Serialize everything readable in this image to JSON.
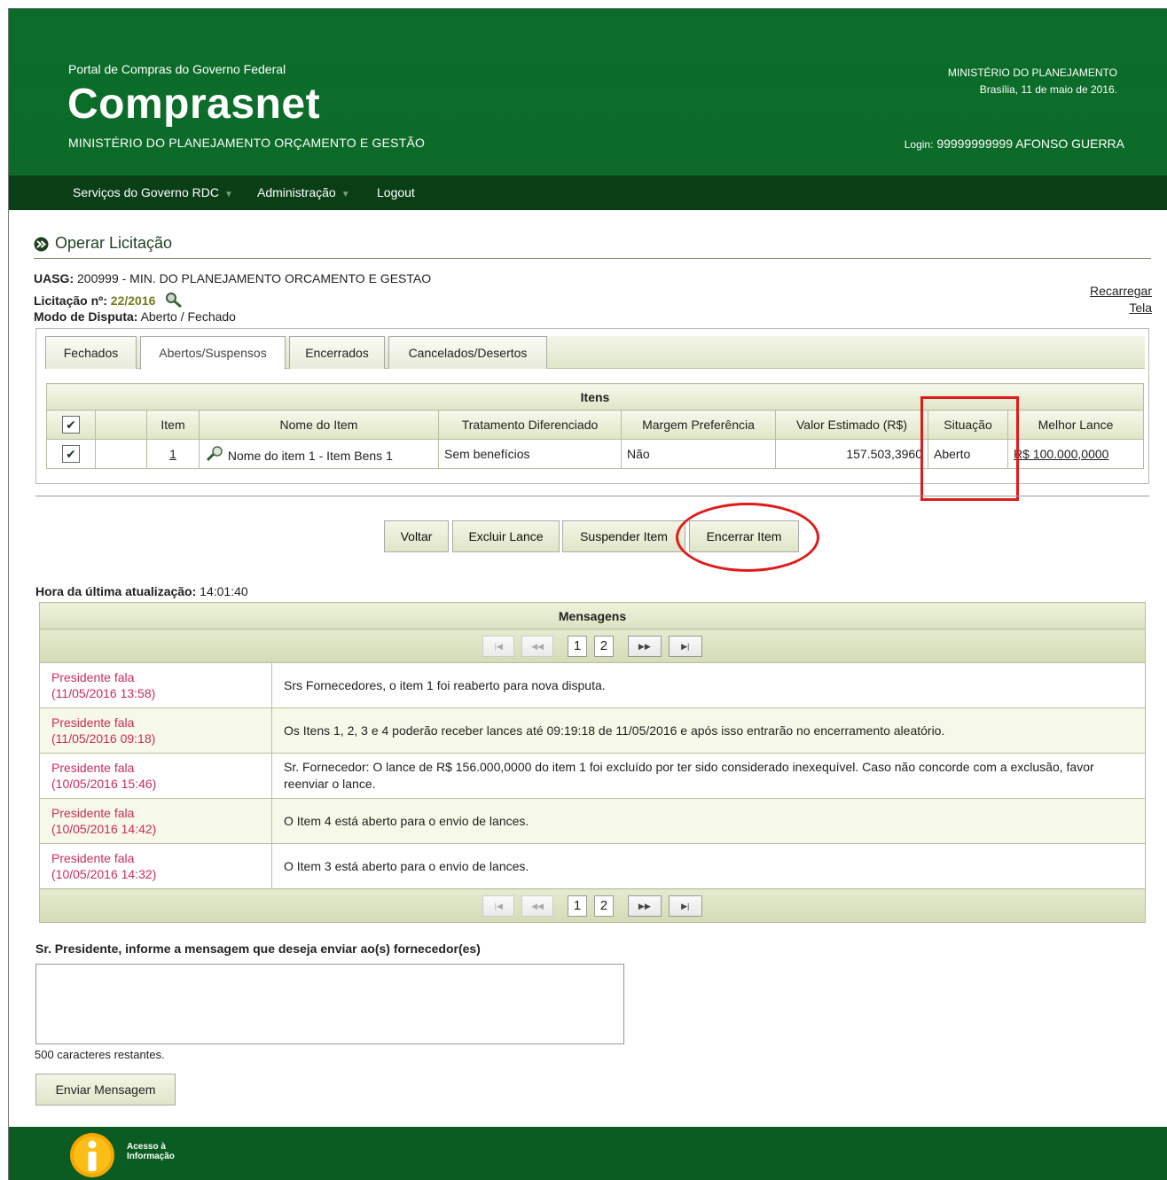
{
  "header": {
    "portal": "Portal de Compras do Governo Federal",
    "brand": "Comprasnet",
    "ministry_sub": "MINISTÉRIO DO PLANEJAMENTO ORÇAMENTO E GESTÃO",
    "right_ministry": "MINISTÉRIO DO PLANEJAMENTO",
    "date": "Brasília, 11 de maio de 2016.",
    "login_label": "Login:",
    "login_user": "99999999999 AFONSO GUERRA"
  },
  "menu": {
    "items": [
      {
        "label": "Serviços do Governo RDC"
      },
      {
        "label": "Administração"
      },
      {
        "label": "Logout"
      }
    ]
  },
  "page": {
    "title": "Operar Licitação",
    "uasg_label": "UASG:",
    "uasg_value": "200999 - MIN. DO PLANEJAMENTO ORCAMENTO E GESTAO",
    "licitacao_label": "Licitação nº:",
    "licitacao_value": "22/2016",
    "modo_label": "Modo de Disputa:",
    "modo_value": "Aberto / Fechado",
    "reload_line1": "Recarregar",
    "reload_line2": "Tela"
  },
  "tabs": [
    {
      "label": "Fechados"
    },
    {
      "label": "Abertos/Suspensos"
    },
    {
      "label": "Encerrados"
    },
    {
      "label": "Cancelados/Desertos"
    }
  ],
  "items_table": {
    "caption": "Itens",
    "columns": [
      "Item",
      "Nome do Item",
      "Tratamento Diferenciado",
      "Margem Preferência",
      "Valor Estimado (R$)",
      "Situação",
      "Melhor Lance"
    ],
    "rows": [
      {
        "item": "1",
        "nome": "Nome do item 1 - Item Bens 1",
        "tratamento": "Sem benefícios",
        "margem": "Não",
        "valor": "157.503,3960",
        "situacao": "Aberto",
        "lance_currency": "R$",
        "lance_value": "100.000,0000"
      }
    ]
  },
  "buttons": {
    "voltar": "Voltar",
    "excluir": "Excluir Lance",
    "suspender": "Suspender Item",
    "encerrar": "Encerrar Item"
  },
  "update": {
    "label": "Hora da última atualização:",
    "time": "14:01:40"
  },
  "messages": {
    "title": "Mensagens",
    "pages": [
      "1",
      "2"
    ],
    "rows": [
      {
        "who": "Presidente fala",
        "when": "(11/05/2016 13:58)",
        "text": "Srs Fornecedores, o item 1 foi reaberto para nova disputa."
      },
      {
        "who": "Presidente fala",
        "when": "(11/05/2016 09:18)",
        "text": "Os Itens 1, 2, 3 e 4 poderão receber lances até 09:19:18 de 11/05/2016 e após isso entrarão no encerramento aleatório."
      },
      {
        "who": "Presidente fala",
        "when": "(10/05/2016 15:46)",
        "text": "Sr. Fornecedor: O lance de R$ 156.000,0000 do item 1 foi excluído por ter sido considerado inexequível. Caso não concorde com a exclusão, favor reenviar o lance."
      },
      {
        "who": "Presidente fala",
        "when": "(10/05/2016 14:42)",
        "text": "O Item 4 está aberto para o envio de lances."
      },
      {
        "who": "Presidente fala",
        "when": "(10/05/2016 14:32)",
        "text": "O Item 3 está aberto para o envio de lances."
      }
    ]
  },
  "compose": {
    "label": "Sr. Presidente, informe a mensagem que deseja enviar ao(s) fornecedor(es)",
    "value": "",
    "remaining": "500 caracteres restantes.",
    "send": "Enviar Mensagem"
  },
  "footer": {
    "acesso_line1": "Acesso à",
    "acesso_line2": "Informação"
  },
  "colors": {
    "header_green": "#0a6e2a",
    "menu_dark_green": "#0a3f16",
    "highlight_red": "#e01b1b",
    "message_author": "#cc2c5a"
  }
}
